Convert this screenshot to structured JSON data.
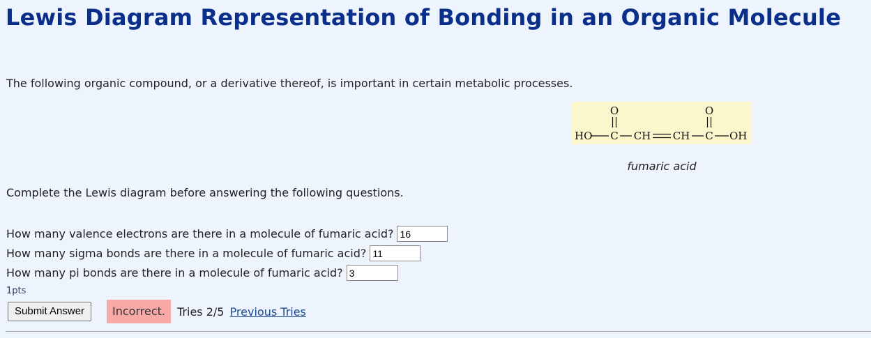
{
  "header": {
    "title": "Lewis Diagram Representation of Bonding in an Organic Molecule"
  },
  "intro_text": "The following organic compound, or a derivative thereof, is important in certain metabolic processes.",
  "figure": {
    "structure": {
      "atoms": [
        "HO",
        "C",
        "CH",
        "CH",
        "C",
        "OH"
      ],
      "top_oxygen": "O"
    },
    "caption": "fumaric acid"
  },
  "instruction_text": "Complete the Lewis diagram before answering the following questions.",
  "questions": [
    {
      "label": "How many valence electrons are there in a molecule of fumaric acid?",
      "value": "16"
    },
    {
      "label": "How many sigma bonds are there in a molecule of fumaric acid?",
      "value": "11"
    },
    {
      "label": "How many pi bonds are there in a molecule of fumaric acid?",
      "value": "3"
    }
  ],
  "points_label": "1pts",
  "submit_label": "Submit Answer",
  "status": {
    "text": "Incorrect.",
    "color": "#f9a8a8"
  },
  "tries": {
    "text": "Tries 2/5",
    "link_label": "Previous Tries"
  },
  "colors": {
    "title": "#0a2f8a",
    "background": "#eef4fd",
    "figure_background": "#fcf6cc",
    "link": "#1a4a8f"
  }
}
